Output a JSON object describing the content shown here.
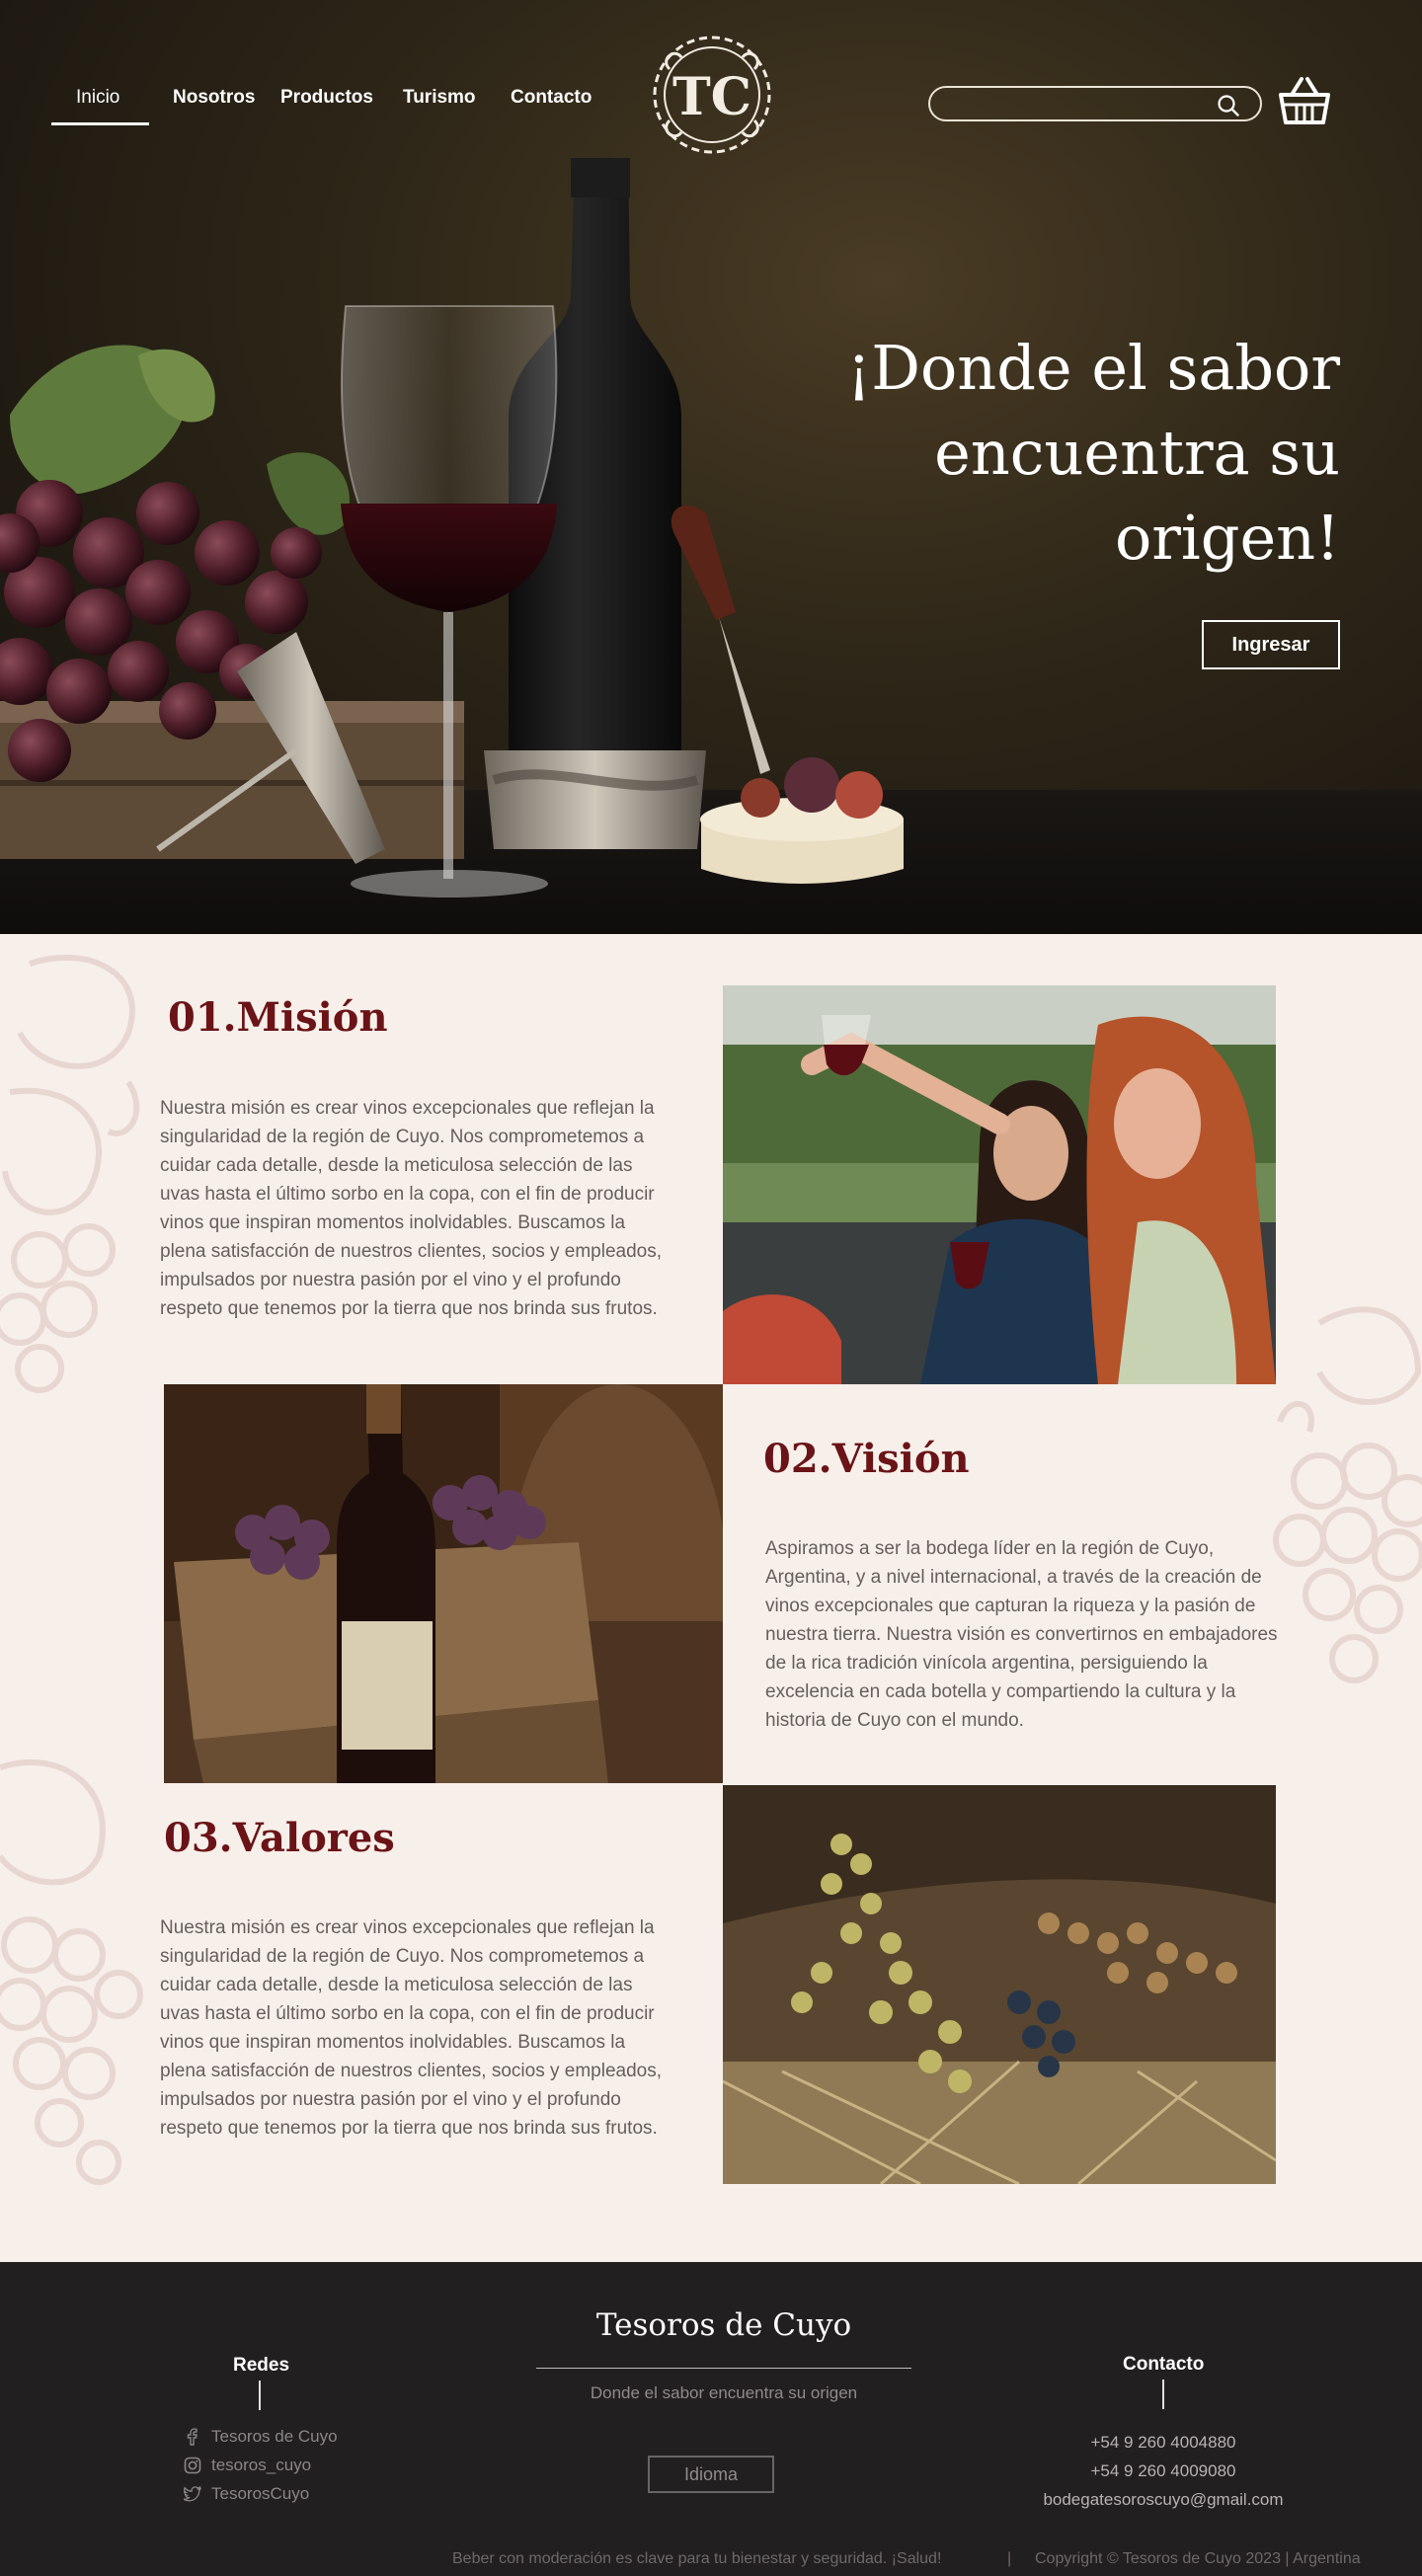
{
  "nav": {
    "items": [
      {
        "label": "Inicio",
        "active": true
      },
      {
        "label": "Nosotros"
      },
      {
        "label": "Productos"
      },
      {
        "label": "Turismo"
      },
      {
        "label": "Contacto"
      }
    ]
  },
  "logo": {
    "monogram": "TC"
  },
  "search": {
    "placeholder": "",
    "icon": "search-icon"
  },
  "cart": {
    "icon": "basket-icon"
  },
  "hero": {
    "title": "¡Donde el sabor encuentra su origen!",
    "button": "Ingresar"
  },
  "sections": [
    {
      "title": "01.Misión",
      "text": "Nuestra misión es crear vinos excepcionales que reflejan la singularidad de la región de Cuyo. Nos comprometemos a cuidar cada detalle, desde la meticulosa selección de las uvas hasta el último sorbo en la copa, con el fin de producir vinos que inspiran momentos inolvidables. Buscamos la plena satisfacción de nuestros clientes, socios y empleados, impulsados por nuestra pasión por el vino y el profundo respeto que tenemos por la tierra que nos brinda sus frutos."
    },
    {
      "title": "02.Visión",
      "text": "Aspiramos a ser la bodega líder en la región de Cuyo, Argentina, y a nivel internacional, a través de la creación de vinos excepcionales que capturan la riqueza y la pasión de nuestra tierra. Nuestra visión es convertirnos en embajadores de la rica tradición vinícola argentina, persiguiendo la excelencia en cada botella y compartiendo la cultura y la historia de Cuyo con el mundo."
    },
    {
      "title": "03.Valores",
      "text": "Nuestra misión es crear vinos excepcionales que reflejan la singularidad de la región de Cuyo. Nos comprometemos a cuidar cada detalle, desde la meticulosa selección de las uvas hasta el último sorbo en la copa, con el fin de producir vinos que inspiran momentos inolvidables. Buscamos la plena satisfacción de nuestros clientes, socios y empleados, impulsados por nuestra pasión por el vino y el profundo respeto que tenemos por la tierra que nos brinda sus frutos."
    }
  ],
  "footer": {
    "redes": {
      "heading": "Redes",
      "items": [
        {
          "label": "Tesoros de Cuyo",
          "icon": "facebook-icon"
        },
        {
          "label": "tesoros_cuyo",
          "icon": "instagram-icon"
        },
        {
          "label": "TesorosCuyo",
          "icon": "twitter-icon"
        }
      ]
    },
    "brand": "Tesoros de Cuyo",
    "tagline": "Donde el sabor encuentra su origen",
    "language_button": "Idioma",
    "contacto": {
      "heading": "Contacto",
      "phone1": "+54 9 260 4004880",
      "phone2": "+54 9 260 4009080",
      "email": "bodegatesoroscuyo@gmail.com"
    },
    "disclaimer": "Beber con moderación es clave para tu bienestar y seguridad. ¡Salud!",
    "separator": "|",
    "copyright": "Copyright © Tesoros de Cuyo  2023 | Argentina"
  },
  "colors": {
    "accent": "#6a1418",
    "hero_bg": "#2f2718",
    "section_bg": "#f7efea",
    "footer_bg": "#221f20"
  }
}
